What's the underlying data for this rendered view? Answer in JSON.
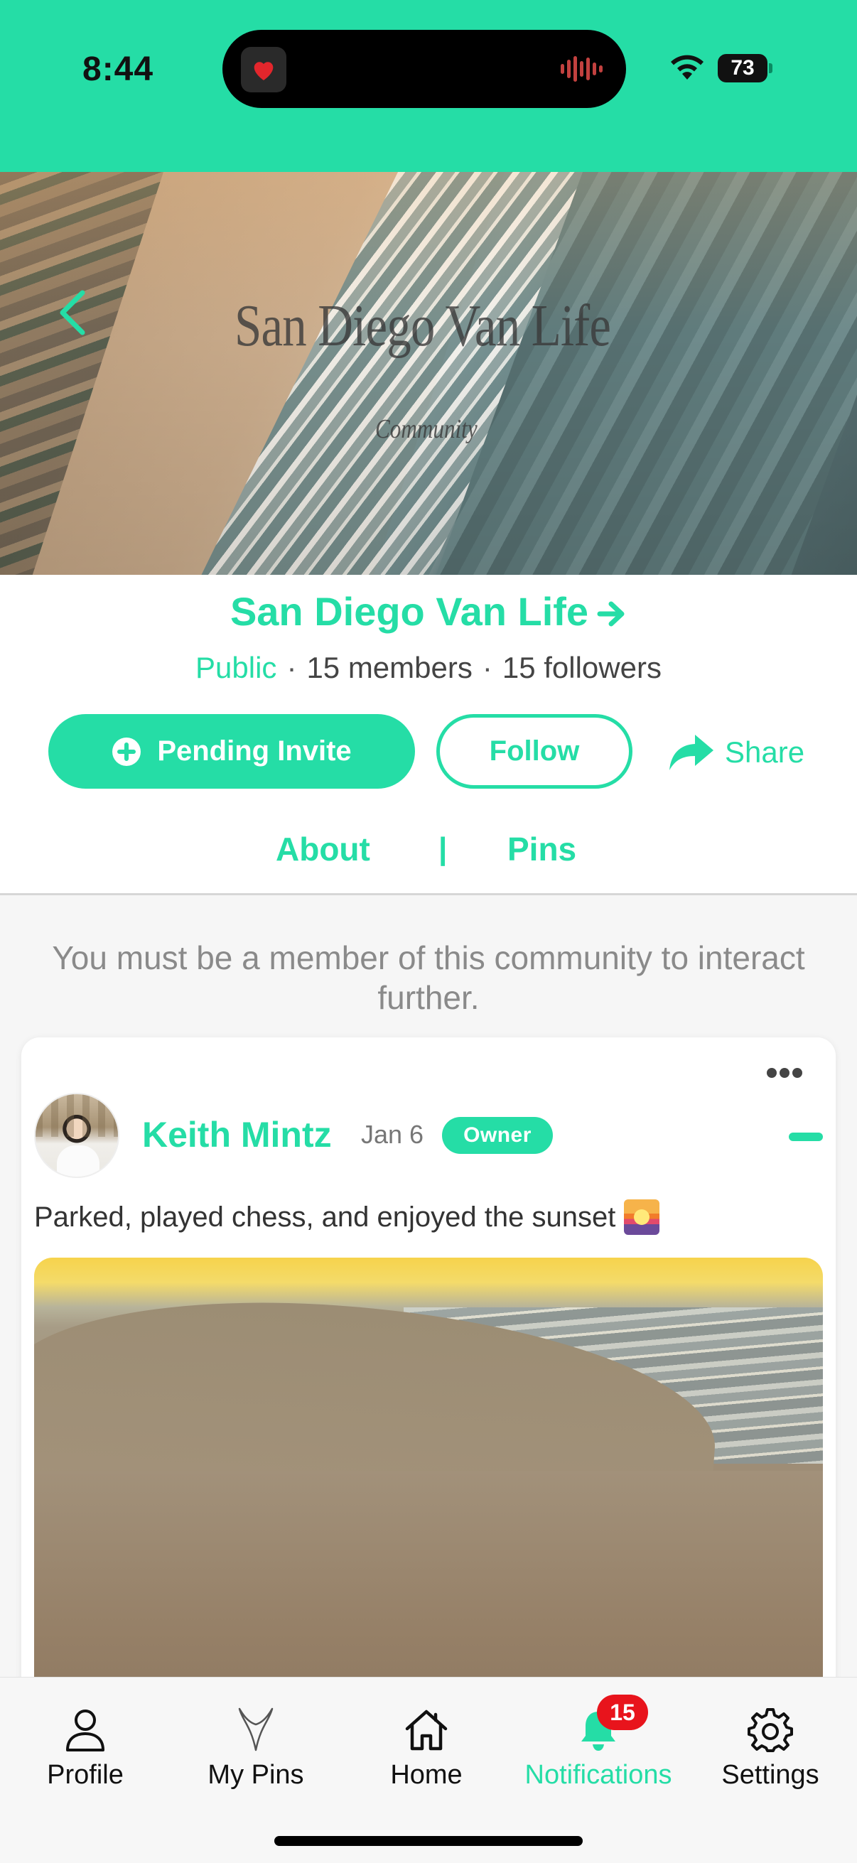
{
  "status_bar": {
    "time": "8:44",
    "battery": "73",
    "battery_level": 0.73,
    "background": "#25DDA6"
  },
  "banner": {
    "title": "San Diego Van Life",
    "subtitle": "Community"
  },
  "community": {
    "name": "San Diego Van Life",
    "visibility": "Public",
    "members": "15 members",
    "followers": "15 followers"
  },
  "actions": {
    "pending_invite": "Pending Invite",
    "follow": "Follow",
    "share": "Share"
  },
  "tabs": {
    "about": "About",
    "separator": "|",
    "pins": "Pins"
  },
  "notice": "You must be a member of this community to interact further.",
  "post": {
    "author": "Keith Mintz",
    "date": "Jan 6",
    "badge": "Owner",
    "text": "Parked, played chess, and enjoyed the sunset"
  },
  "tab_bar": {
    "items": [
      {
        "label": "Profile",
        "icon": "person-icon"
      },
      {
        "label": "My Pins",
        "icon": "pin-icon"
      },
      {
        "label": "Home",
        "icon": "home-icon"
      },
      {
        "label": "Notifications",
        "icon": "bell-icon",
        "active": true
      },
      {
        "label": "Settings",
        "icon": "gear-icon"
      }
    ],
    "notification_count": "15"
  },
  "colors": {
    "accent": "#25DDA6",
    "badge_red": "#E8141C"
  }
}
